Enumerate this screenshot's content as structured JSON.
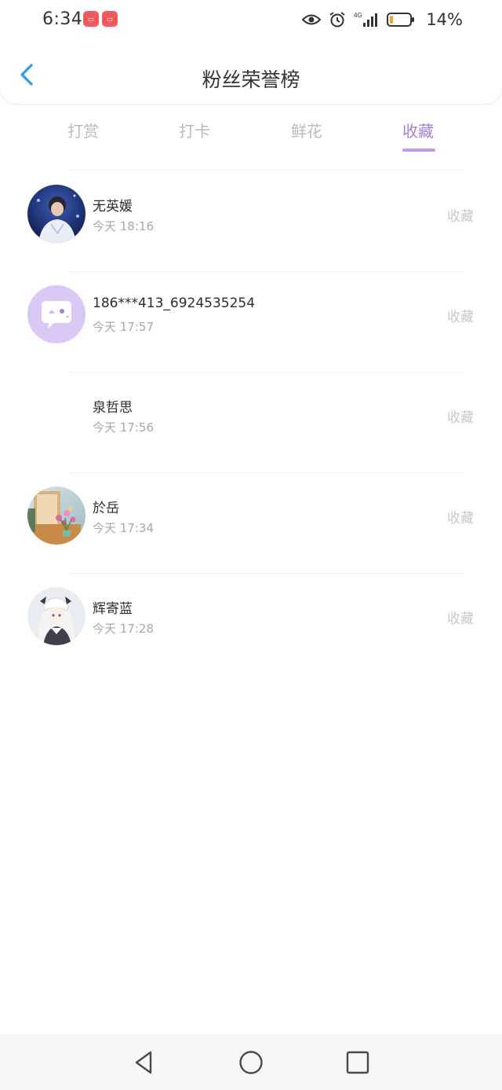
{
  "status_bar": {
    "time": "6:34",
    "notification_icons": [
      "app-badge-icon",
      "app-badge-icon"
    ],
    "right_icons": [
      "eye-icon",
      "alarm-icon",
      "signal-4g-icon",
      "battery-icon"
    ],
    "network_label": "4G",
    "battery_percent": "14%",
    "battery_level": 0.14,
    "battery_color": "#f5a623"
  },
  "header": {
    "title": "粉丝荣誉榜",
    "back_icon": "chevron-left-icon",
    "accent": "#2b9bf0"
  },
  "tabs": {
    "items": [
      {
        "label": "打赏",
        "active": false
      },
      {
        "label": "打卡",
        "active": false
      },
      {
        "label": "鲜花",
        "active": false
      },
      {
        "label": "收藏",
        "active": true
      }
    ],
    "active_color": "#a47fd8",
    "inactive_color": "#b9b9c0"
  },
  "fans": [
    {
      "name": "无英媛",
      "time": "今天 18:16",
      "action": "收藏",
      "avatar": "person-photo-avatar"
    },
    {
      "name": "186***413_6924535254",
      "time": "今天 17:57",
      "action": "收藏",
      "avatar": "chat-bubble-default-avatar"
    },
    {
      "name": "泉哲思",
      "time": "今天 17:56",
      "action": "收藏",
      "avatar": "empty-avatar"
    },
    {
      "name": "於岳",
      "time": "今天 17:34",
      "action": "收藏",
      "avatar": "flowers-photo-avatar"
    },
    {
      "name": "辉寄蓝",
      "time": "今天 17:28",
      "action": "收藏",
      "avatar": "anime-girl-avatar"
    }
  ],
  "system_nav": {
    "icons": [
      "back-triangle-icon",
      "home-circle-icon",
      "recents-square-icon"
    ]
  }
}
